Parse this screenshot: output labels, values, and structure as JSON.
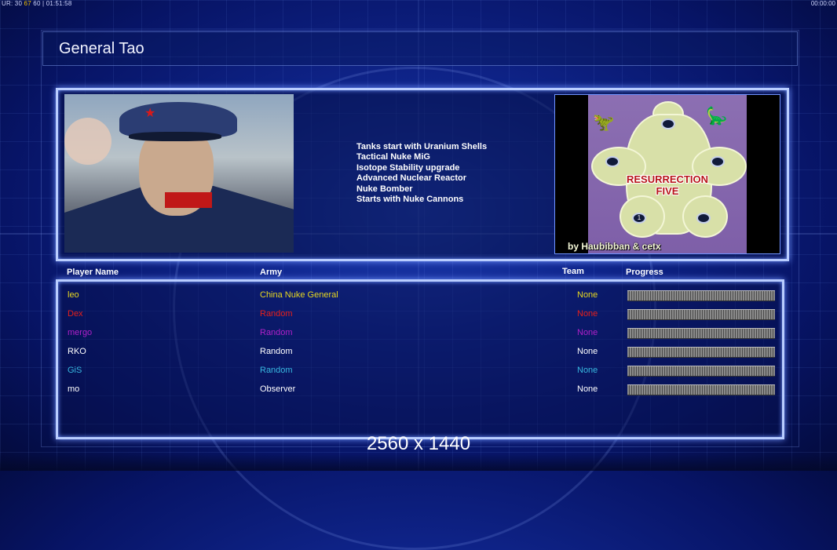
{
  "debug": {
    "left_prefix": "UR: 30",
    "fps": "67",
    "left_suffix": "60",
    "clock": "01:51:58",
    "right_clock": "00:00:00"
  },
  "header": {
    "title": "General Tao"
  },
  "general": {
    "traits": [
      "Tanks start with Uranium Shells",
      "Tactical Nuke MiG",
      "Isotope Stability upgrade",
      "Advanced Nuclear Reactor",
      "Nuke Bomber",
      "Starts with Nuke Cannons"
    ]
  },
  "map": {
    "title_line1": "RESURRECTION",
    "title_line2": "FIVE",
    "credit": "by Haubibban & cetx",
    "marker": "1"
  },
  "players_table": {
    "headers": {
      "name": "Player Name",
      "army": "Army",
      "team": "Team",
      "progress": "Progress"
    },
    "rows": [
      {
        "name": "leo",
        "army": "China Nuke General",
        "team": "None",
        "color": "#e8d820"
      },
      {
        "name": "Dex",
        "army": "Random",
        "team": "None",
        "color": "#e8201a"
      },
      {
        "name": "mergo",
        "army": "Random",
        "team": "None",
        "color": "#b020c8"
      },
      {
        "name": "RKO",
        "army": "Random",
        "team": "None",
        "color": "#ffffff"
      },
      {
        "name": "GiS",
        "army": "Random",
        "team": "None",
        "color": "#38b8e0"
      },
      {
        "name": "mo",
        "army": "Observer",
        "team": "None",
        "color": "#ffffff"
      }
    ]
  },
  "footer": {
    "resolution": "2560 x 1440"
  }
}
